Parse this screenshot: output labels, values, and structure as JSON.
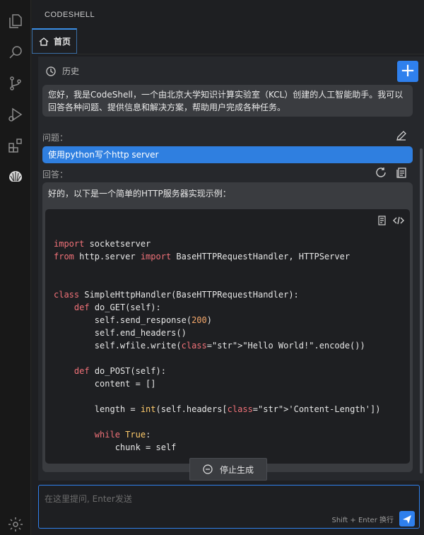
{
  "activity_bar": {
    "items": [
      {
        "icon": "explorer-icon"
      },
      {
        "icon": "search-icon"
      },
      {
        "icon": "source-control-icon"
      },
      {
        "icon": "run-debug-icon"
      },
      {
        "icon": "extensions-icon"
      },
      {
        "icon": "codeshell-icon"
      }
    ],
    "bottom": {
      "icon": "settings-gear-icon"
    }
  },
  "panel": {
    "title": "CODESHELL",
    "tab": {
      "label": "首页",
      "icon": "home-icon"
    }
  },
  "chat": {
    "history_label": "历史",
    "new_chat_label": "+",
    "intro": "您好，我是CodeShell，一个由北京大学知识计算实验室（KCL）创建的人工智能助手。我可以回答各种问题、提供信息和解决方案，帮助用户完成各种任务。",
    "question_label": "问题：",
    "question": "使用python写个http server",
    "answer_label": "回答：",
    "answer_intro": "好的，以下是一个简单的HTTP服务器实现示例：",
    "code_lines": [
      "import socketserver",
      "from http.server import BaseHTTPRequestHandler, HTTPServer",
      "",
      "",
      "class SimpleHttpHandler(BaseHTTPRequestHandler):",
      "    def do_GET(self):",
      "        self.send_response(200)",
      "        self.end_headers()",
      "        self.wfile.write(\"Hello World!\".encode())",
      "",
      "    def do_POST(self):",
      "        content = []",
      "",
      "        length = int(self.headers['Content-Length'])",
      "",
      "        while True:",
      "            chunk = self"
    ],
    "stop_label": "停止生成"
  },
  "input": {
    "placeholder": "在这里提问, Enter发送",
    "hint": "Shift + Enter 换行"
  },
  "colors": {
    "accent": "#2f80ed",
    "keyword": "#f07178",
    "string": "#c3e88d",
    "number": "#f5a86b"
  }
}
